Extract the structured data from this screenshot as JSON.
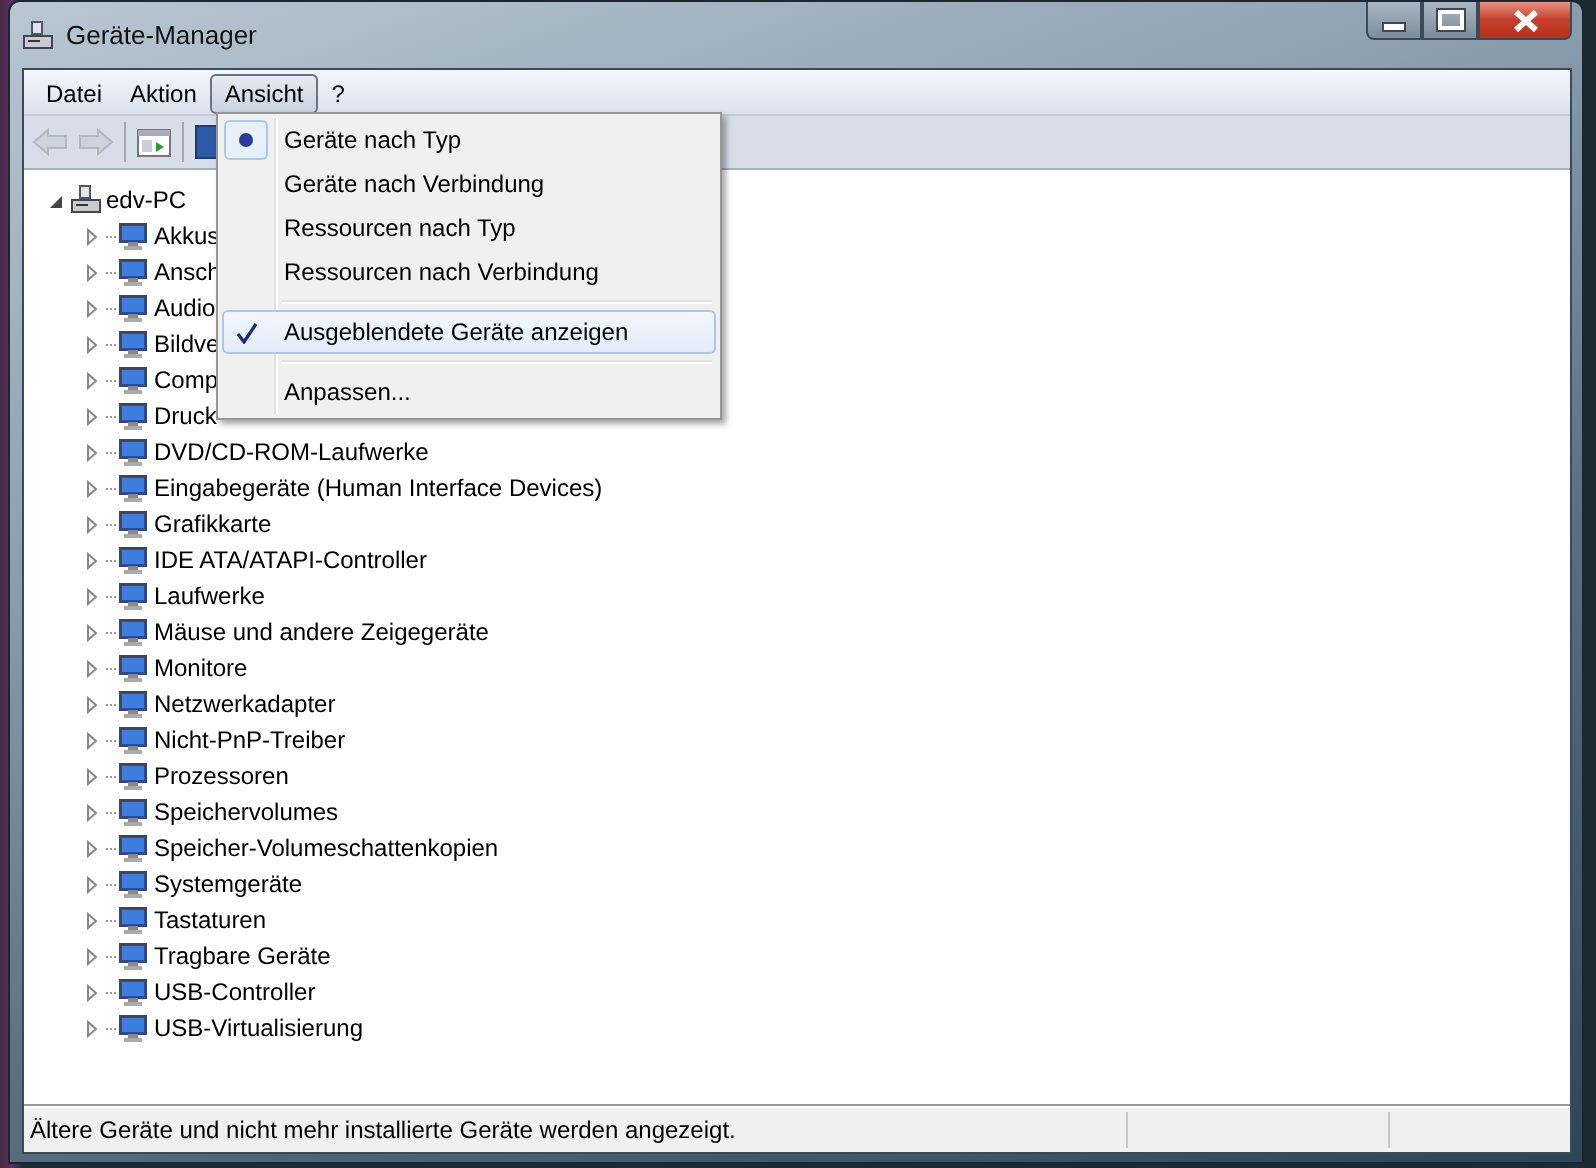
{
  "window": {
    "title": "Geräte-Manager"
  },
  "menu_bar": [
    {
      "label": "Datei",
      "selected": false
    },
    {
      "label": "Aktion",
      "selected": false
    },
    {
      "label": "Ansicht",
      "selected": true
    },
    {
      "label": "?",
      "selected": false
    }
  ],
  "toolbar": [
    {
      "kind": "back",
      "disabled": true
    },
    {
      "kind": "forward",
      "disabled": true
    },
    {
      "kind": "properties",
      "disabled": false
    },
    {
      "kind": "blue",
      "disabled": false
    }
  ],
  "menu": [
    {
      "kind": "radio",
      "label": "Geräte nach Typ",
      "checked": true,
      "selected": false
    },
    {
      "kind": "radio",
      "label": "Geräte nach Verbindung",
      "checked": false,
      "selected": false
    },
    {
      "kind": "radio",
      "label": "Ressourcen nach Typ",
      "checked": false,
      "selected": false
    },
    {
      "kind": "radio",
      "label": "Ressourcen nach Verbindung",
      "checked": false,
      "selected": false
    },
    {
      "kind": "separator"
    },
    {
      "kind": "check",
      "label": "Ausgeblendete Geräte anzeigen",
      "checked": true,
      "selected": true
    },
    {
      "kind": "separator"
    },
    {
      "kind": "command",
      "label": "Anpassen...",
      "selected": false
    }
  ],
  "tree": {
    "label": "edv-PC",
    "expanded": true,
    "children": [
      {
        "label": "Akkus",
        "expanded": false
      },
      {
        "label": "Ansch",
        "expanded": false
      },
      {
        "label": "Audio",
        "expanded": false
      },
      {
        "label": "Bildve",
        "expanded": false
      },
      {
        "label": "Comp",
        "expanded": false
      },
      {
        "label": "Druck",
        "expanded": false
      },
      {
        "label": "DVD/CD-ROM-Laufwerke",
        "expanded": false
      },
      {
        "label": "Eingabegeräte (Human Interface Devices)",
        "expanded": false
      },
      {
        "label": "Grafikkarte",
        "expanded": false
      },
      {
        "label": "IDE ATA/ATAPI-Controller",
        "expanded": false
      },
      {
        "label": "Laufwerke",
        "expanded": false
      },
      {
        "label": "Mäuse und andere Zeigegeräte",
        "expanded": false
      },
      {
        "label": "Monitore",
        "expanded": false
      },
      {
        "label": "Netzwerkadapter",
        "expanded": false
      },
      {
        "label": "Nicht-PnP-Treiber",
        "expanded": false
      },
      {
        "label": "Prozessoren",
        "expanded": false
      },
      {
        "label": "Speichervolumes",
        "expanded": false
      },
      {
        "label": "Speicher-Volumeschattenkopien",
        "expanded": false
      },
      {
        "label": "Systemgeräte",
        "expanded": false
      },
      {
        "label": "Tastaturen",
        "expanded": false
      },
      {
        "label": "Tragbare Geräte",
        "expanded": false
      },
      {
        "label": "USB-Controller",
        "expanded": false
      },
      {
        "label": "USB-Virtualisierung",
        "expanded": false
      }
    ]
  },
  "status_bar": {
    "text": "Ältere Geräte und nicht mehr installierte Geräte werden angezeigt."
  }
}
